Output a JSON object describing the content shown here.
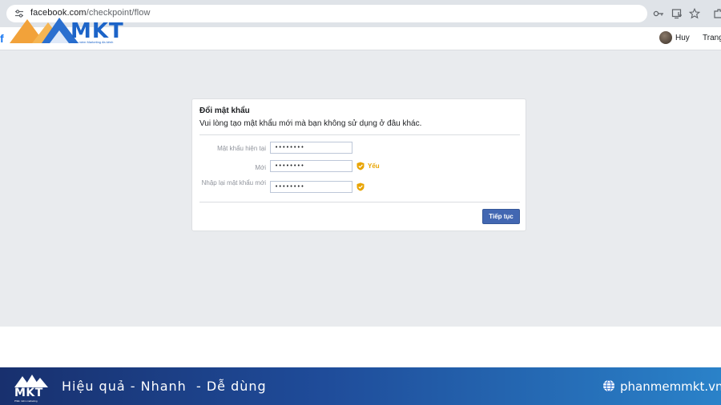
{
  "browser": {
    "url_domain": "facebook.com",
    "url_path": "/checkpoint/flow",
    "icons": [
      "tune-icon",
      "key-icon",
      "install-app-icon",
      "star-icon",
      "extensions-icon"
    ]
  },
  "facebook_header": {
    "logo_fragment": "f",
    "user_name": "Huy",
    "home_link": "Trang"
  },
  "watermark": {
    "word": "MKT",
    "subtitle": "Phần mềm Marketing đa kênh"
  },
  "dialog": {
    "title": "Đổi mật khẩu",
    "description": "Vui lòng tạo mật khẩu mới mà bạn không sử dụng ở đâu khác.",
    "fields": [
      {
        "label": "Mật khẩu hiện tại",
        "value": "••••••••"
      },
      {
        "label": "Mới",
        "value": "••••••••",
        "strength": "Yếu"
      },
      {
        "label": "Nhập lại mật khẩu mới",
        "value": "••••••••"
      }
    ],
    "submit_label": "Tiếp tục",
    "colors": {
      "button": "#4267b2",
      "strength": "#e8a400"
    }
  },
  "banner": {
    "logo_word": "MKT",
    "logo_subtitle": "Phần mềm marketing",
    "slogan": "Hiệu quả - Nhanh  - Dễ dùng",
    "website": "phanmemmkt.vn",
    "colors": {
      "start": "#18306e",
      "end": "#2a82c9"
    }
  }
}
